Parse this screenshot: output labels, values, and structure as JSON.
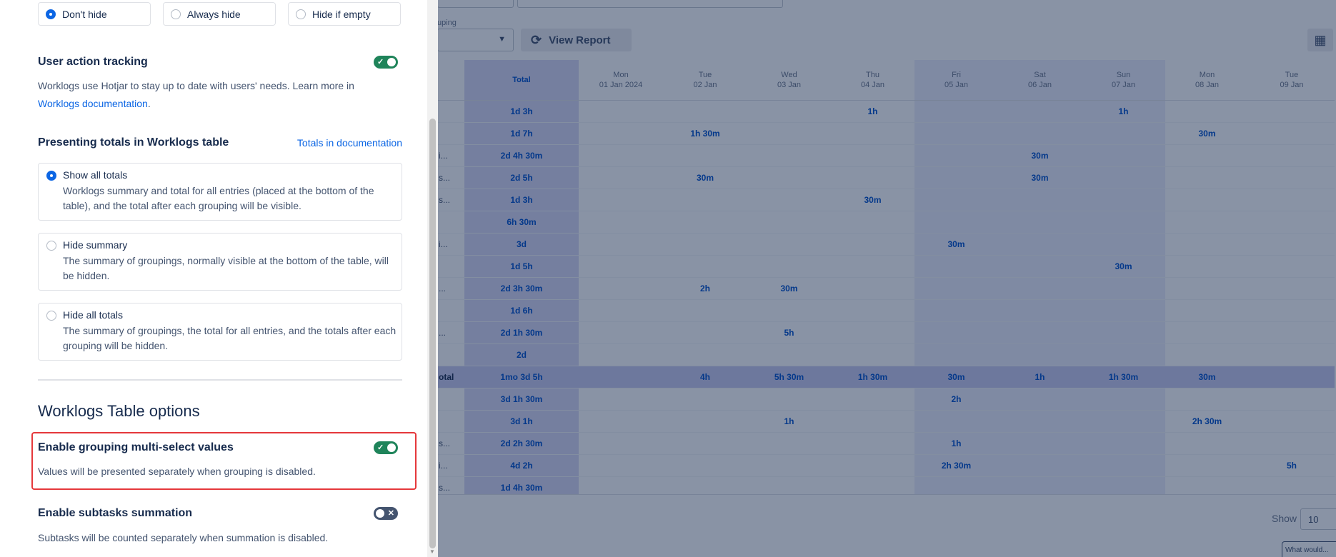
{
  "panel": {
    "visibility_options": [
      {
        "label": "Don't hide",
        "selected": true
      },
      {
        "label": "Always hide",
        "selected": false
      },
      {
        "label": "Hide if empty",
        "selected": false
      }
    ],
    "user_action_tracking": {
      "title": "User action tracking",
      "enabled": true,
      "description": "Worklogs use Hotjar to stay up to date with users' needs. Learn more in",
      "link": "Worklogs documentation",
      "link_suffix": "."
    },
    "totals": {
      "title": "Presenting totals in Worklogs table",
      "doc_link": "Totals in documentation",
      "options": [
        {
          "title": "Show all totals",
          "description": "Worklogs summary and total for all entries (placed at the bottom of the table), and the total after each grouping will be visible.",
          "selected": true
        },
        {
          "title": "Hide summary",
          "description": "The summary of groupings, normally visible at the bottom of the table, will be hidden.",
          "selected": false
        },
        {
          "title": "Hide all totals",
          "description": "The summary of groupings, the total for all entries, and the totals after each grouping will be hidden.",
          "selected": false
        }
      ]
    },
    "table_options_title": "Worklogs Table options",
    "grouping_multi_select": {
      "title": "Enable grouping multi-select values",
      "enabled": true,
      "description": "Values will be presented separately when grouping is disabled."
    },
    "subtasks_summation": {
      "title": "Enable subtasks summation",
      "enabled": false,
      "description": "Subtasks will be counted separately when summation is disabled."
    }
  },
  "background": {
    "grouping_label": "uping",
    "view_report": "View Report",
    "columns": [
      {
        "day": "Total",
        "date": ""
      },
      {
        "day": "Mon",
        "date": "01 Jan 2024"
      },
      {
        "day": "Tue",
        "date": "02 Jan"
      },
      {
        "day": "Wed",
        "date": "03 Jan"
      },
      {
        "day": "Thu",
        "date": "04 Jan"
      },
      {
        "day": "Fri",
        "date": "05 Jan"
      },
      {
        "day": "Sat",
        "date": "06 Jan"
      },
      {
        "day": "Sun",
        "date": "07 Jan"
      },
      {
        "day": "Mon",
        "date": "08 Jan"
      },
      {
        "day": "Tue",
        "date": "09 Jan"
      }
    ],
    "rows": [
      {
        "label": "",
        "total": "1d 3h",
        "cells": [
          "",
          "",
          "",
          "1h",
          "",
          "",
          "1h",
          "",
          ""
        ]
      },
      {
        "label": "",
        "total": "1d 7h",
        "cells": [
          "",
          "1h 30m",
          "",
          "",
          "",
          "",
          "",
          "30m",
          ""
        ]
      },
      {
        "label": "i...",
        "total": "2d 4h 30m",
        "cells": [
          "",
          "",
          "",
          "",
          "",
          "30m",
          "",
          "",
          ""
        ]
      },
      {
        "label": "s...",
        "total": "2d 5h",
        "cells": [
          "",
          "30m",
          "",
          "",
          "",
          "30m",
          "",
          "",
          ""
        ]
      },
      {
        "label": "s...",
        "total": "1d 3h",
        "cells": [
          "",
          "",
          "",
          "30m",
          "",
          "",
          "",
          "",
          ""
        ]
      },
      {
        "label": "",
        "total": "6h 30m",
        "cells": [
          "",
          "",
          "",
          "",
          "",
          "",
          "",
          "",
          ""
        ]
      },
      {
        "label": "i...",
        "total": "3d",
        "cells": [
          "",
          "",
          "",
          "",
          "30m",
          "",
          "",
          "",
          ""
        ]
      },
      {
        "label": "",
        "total": "1d 5h",
        "cells": [
          "",
          "",
          "",
          "",
          "",
          "",
          "30m",
          "",
          ""
        ]
      },
      {
        "label": "...",
        "total": "2d 3h 30m",
        "cells": [
          "",
          "2h",
          "30m",
          "",
          "",
          "",
          "",
          "",
          ""
        ]
      },
      {
        "label": "",
        "total": "1d 6h",
        "cells": [
          "",
          "",
          "",
          "",
          "",
          "",
          "",
          "",
          ""
        ]
      },
      {
        "label": "...",
        "total": "2d 1h 30m",
        "cells": [
          "",
          "",
          "5h",
          "",
          "",
          "",
          "",
          "",
          ""
        ]
      },
      {
        "label": "",
        "total": "2d",
        "cells": [
          "",
          "",
          "",
          "",
          "",
          "",
          "",
          "",
          ""
        ]
      },
      {
        "label": "otal",
        "total": "1mo 3d 5h",
        "cells": [
          "",
          "4h",
          "5h 30m",
          "1h 30m",
          "30m",
          "1h",
          "1h 30m",
          "30m",
          ""
        ],
        "summary": true
      },
      {
        "label": "",
        "total": "3d 1h 30m",
        "cells": [
          "",
          "",
          "",
          "",
          "2h",
          "",
          "",
          "",
          ""
        ]
      },
      {
        "label": "",
        "total": "3d 1h",
        "cells": [
          "",
          "",
          "1h",
          "",
          "",
          "",
          "",
          "2h 30m",
          ""
        ]
      },
      {
        "label": "s...",
        "total": "2d 2h 30m",
        "cells": [
          "",
          "",
          "",
          "",
          "1h",
          "",
          "",
          "",
          ""
        ]
      },
      {
        "label": "i...",
        "total": "4d 2h",
        "cells": [
          "",
          "",
          "",
          "",
          "2h 30m",
          "",
          "",
          "",
          "5h"
        ]
      },
      {
        "label": "s...",
        "total": "1d 4h 30m",
        "cells": [
          "",
          "",
          "",
          "",
          "",
          "",
          "",
          "",
          ""
        ]
      },
      {
        "label": "",
        "total": "",
        "cells": [
          "",
          "",
          "",
          "",
          "",
          "",
          "",
          "",
          ""
        ]
      }
    ],
    "show_label": "Show",
    "show_value": "10",
    "help_text": "What would..."
  }
}
